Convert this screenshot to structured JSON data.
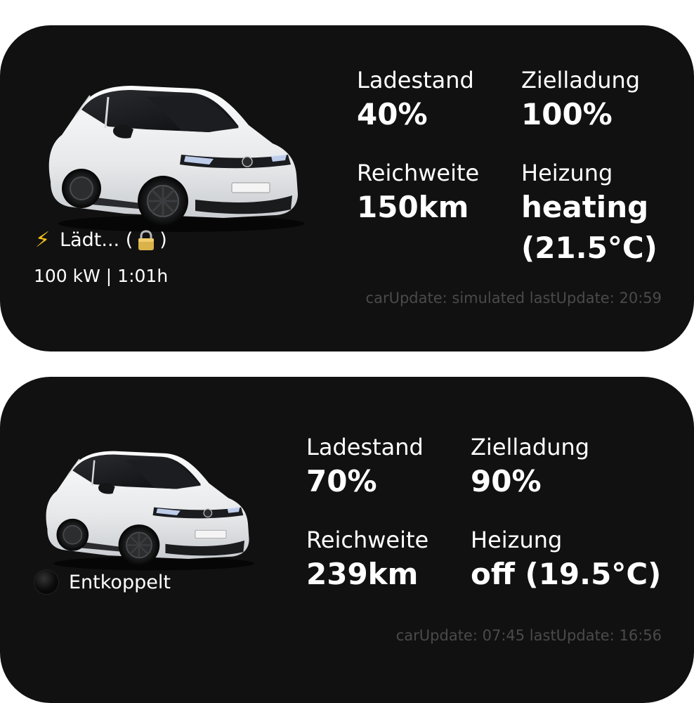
{
  "widgets": [
    {
      "status_label": "Lädt... (",
      "status_suffix": ")",
      "status_icon": "lightning-bolt-icon",
      "lock_icon": "padlock-icon",
      "detail": "100 kW | 1:01h",
      "ladestand_label": "Ladestand",
      "ladestand_value": "40%",
      "zielladung_label": "Zielladung",
      "zielladung_value": "100%",
      "reichweite_label": "Reichweite",
      "reichweite_value": "150km",
      "heizung_label": "Heizung",
      "heizung_value": "heating (21.5°C)",
      "footer": "carUpdate: simulated lastUpdate: 20:59"
    },
    {
      "status_label": "Entkoppelt",
      "status_icon": "black-circle-icon",
      "ladestand_label": "Ladestand",
      "ladestand_value": "70%",
      "zielladung_label": "Zielladung",
      "zielladung_value": "90%",
      "reichweite_label": "Reichweite",
      "reichweite_value": "239km",
      "heizung_label": "Heizung",
      "heizung_value": "off (19.5°C)",
      "footer": "carUpdate: 07:45 lastUpdate: 16:56"
    }
  ],
  "colors": {
    "widget_background": "#111111",
    "text": "#ffffff",
    "footer_text": "#4a4a4a",
    "bolt": "#f6c21a",
    "car_body": "#eeeff1"
  }
}
